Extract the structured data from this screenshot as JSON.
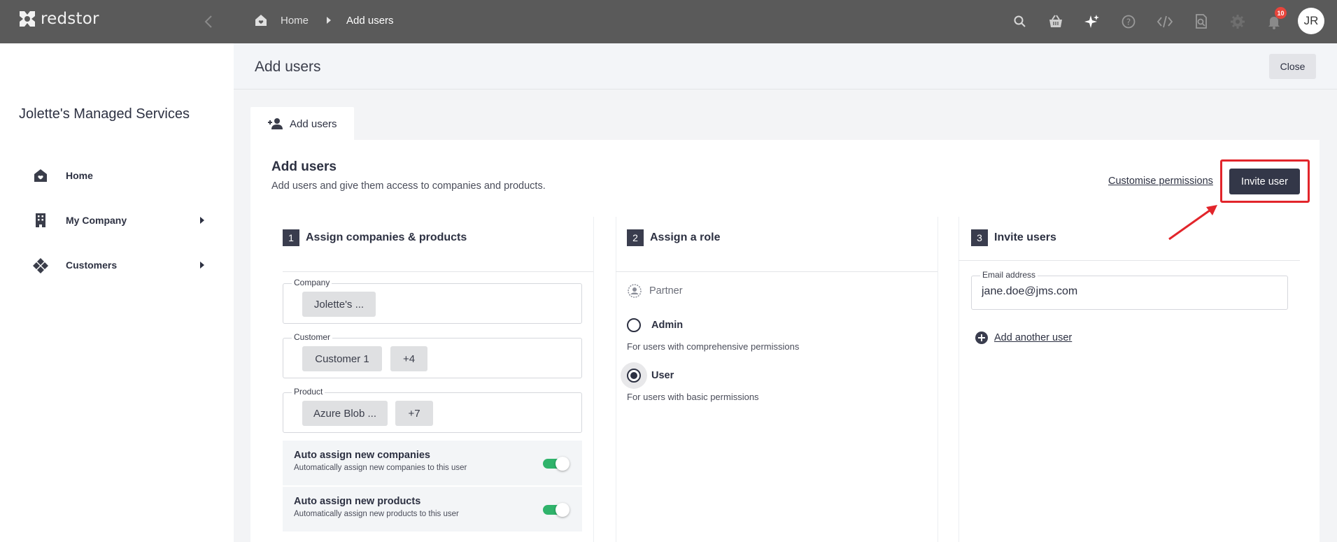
{
  "app": {
    "brand": "redstor",
    "breadcrumb": {
      "home": "Home",
      "current": "Add users"
    },
    "notification_count": "10",
    "avatar_initials": "JR",
    "top_icons": [
      "search-icon",
      "basket-icon",
      "sparkle-icon",
      "help-icon",
      "code-icon",
      "document-search-icon",
      "gear-icon",
      "bell-icon"
    ]
  },
  "sidebar": {
    "org_name": "Jolette's Managed Services",
    "items": [
      {
        "label": "Home",
        "icon": "home-icon"
      },
      {
        "label": "My Company",
        "icon": "building-icon"
      },
      {
        "label": "Customers",
        "icon": "customers-icon"
      }
    ]
  },
  "page": {
    "title": "Add users",
    "close_label": "Close",
    "tab_label": "Add users",
    "section_title": "Add users",
    "section_desc": "Add users and give them access to companies and products.",
    "customise_link": "Customise permissions",
    "invite_button": "Invite user"
  },
  "step1": {
    "num": "1",
    "title": "Assign companies & products",
    "company": {
      "label": "Company",
      "chips": [
        "Jolette's ..."
      ]
    },
    "customer": {
      "label": "Customer",
      "chips": [
        "Customer 1",
        "+4"
      ]
    },
    "product": {
      "label": "Product",
      "chips": [
        "Azure Blob ...",
        "+7"
      ]
    },
    "auto_companies": {
      "title": "Auto assign new companies",
      "sub": "Automatically assign new companies to this user",
      "on": true
    },
    "auto_products": {
      "title": "Auto assign new products",
      "sub": "Automatically assign new products to this user",
      "on": true
    }
  },
  "step2": {
    "num": "2",
    "title": "Assign a role",
    "group": "Partner",
    "roles": [
      {
        "label": "Admin",
        "desc": "For users with comprehensive permissions",
        "selected": false
      },
      {
        "label": "User",
        "desc": "For users with basic permissions",
        "selected": true
      }
    ]
  },
  "step3": {
    "num": "3",
    "title": "Invite users",
    "email_label": "Email address",
    "email_value": "jane.doe@jms.com",
    "add_another": "Add another user"
  },
  "colors": {
    "topbar": "#5a5a5a",
    "primary": "#333748",
    "toggle_on": "#2fb36b",
    "highlight": "#e2252b",
    "badge": "#e6453c"
  }
}
